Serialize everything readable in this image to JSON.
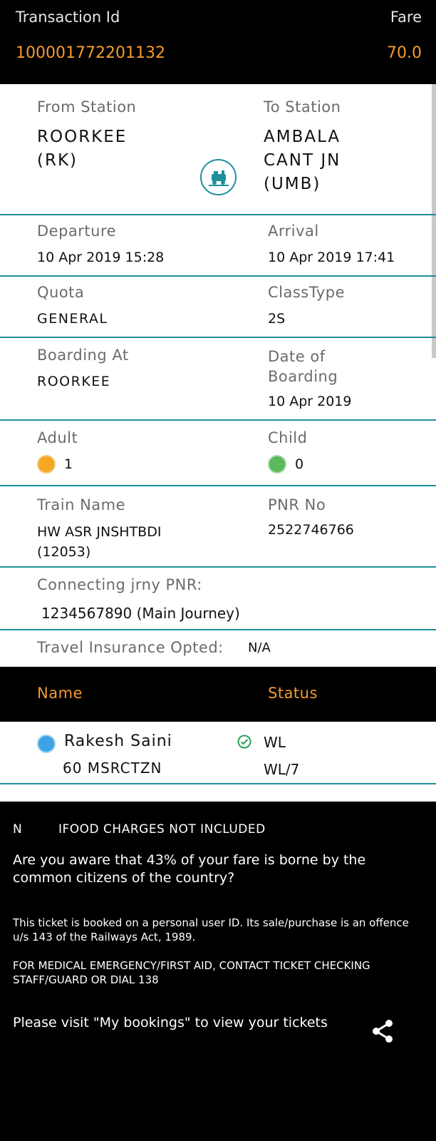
{
  "header": {
    "transaction_label": "Transaction Id",
    "transaction_value": "100001772201132",
    "fare_label": "Fare",
    "fare_value": "70.0"
  },
  "journey": {
    "from_label": "From Station",
    "from_value": "ROORKEE (RK)",
    "to_label": "To Station",
    "to_value": "AMBALA CANT JN (UMB)",
    "train_icon": "train-icon"
  },
  "departure": {
    "label": "Departure",
    "value": "10 Apr 2019 15:28"
  },
  "arrival": {
    "label": "Arrival",
    "value": "10 Apr 2019 17:41"
  },
  "quota": {
    "label": "Quota",
    "value": "GENERAL"
  },
  "class_type": {
    "label": "ClassType",
    "value": "2S"
  },
  "boarding_at": {
    "label": "Boarding At",
    "value": "ROORKEE"
  },
  "date_of_boarding": {
    "label": "Date of Boarding",
    "value": "10 Apr 2019"
  },
  "adult": {
    "label": "Adult",
    "value": "1",
    "icon": "adult-icon"
  },
  "child": {
    "label": "Child",
    "value": "0",
    "icon": "child-icon"
  },
  "train_name": {
    "label": "Train Name",
    "value": "HW ASR JNSHTBDI (12053)"
  },
  "pnr": {
    "label": "PNR No",
    "value": "2522746766"
  },
  "connecting": {
    "label": "Connecting jrny PNR:",
    "value": "1234567890 (Main Journey)"
  },
  "insurance": {
    "label": "Travel Insurance Opted:",
    "value": "N/A"
  },
  "passenger_table": {
    "name_header": "Name",
    "status_header": "Status",
    "rows": [
      {
        "name": "Rakesh Saini",
        "details": "60 MSRCTZN",
        "status": "WL",
        "substatus": "WL/7"
      }
    ]
  },
  "footer": {
    "food_prefix": "N",
    "food_text": "IFOOD CHARGES NOT INCLUDED",
    "aware_text": "Are you aware that 43% of your fare is borne by the common citizens of the country?",
    "personal_text": "This ticket is booked on a personal user ID. Its sale/purchase is an offence u/s 143 of the Railways Act, 1989.",
    "medical_text": "FOR MEDICAL EMERGENCY/FIRST AID, CONTACT TICKET CHECKING STAFF/GUARD OR DIAL 138",
    "visit_text": "Please visit \"My bookings\" to view your tickets",
    "share_icon": "share-icon"
  },
  "colors": {
    "accent": "#f59a2f",
    "divider": "#1f8f99",
    "background": "#000000"
  }
}
